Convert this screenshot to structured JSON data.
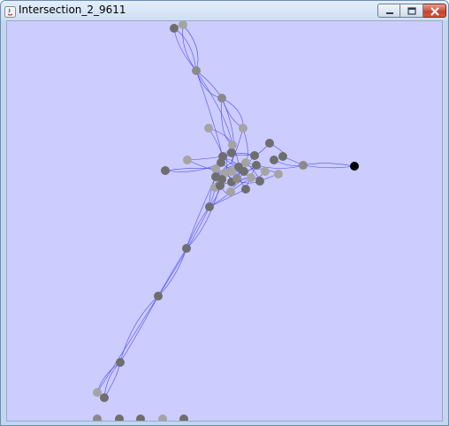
{
  "window": {
    "title": "Intersection_2_9611",
    "controls": [
      "minimize",
      "maximize",
      "close"
    ]
  },
  "graph": {
    "background": "#ccccff",
    "edge_color": "#3a3ae8",
    "node_colors": {
      "dark": "#6e6e6e",
      "light": "#a4a4a4",
      "selected": "#000000"
    }
  }
}
